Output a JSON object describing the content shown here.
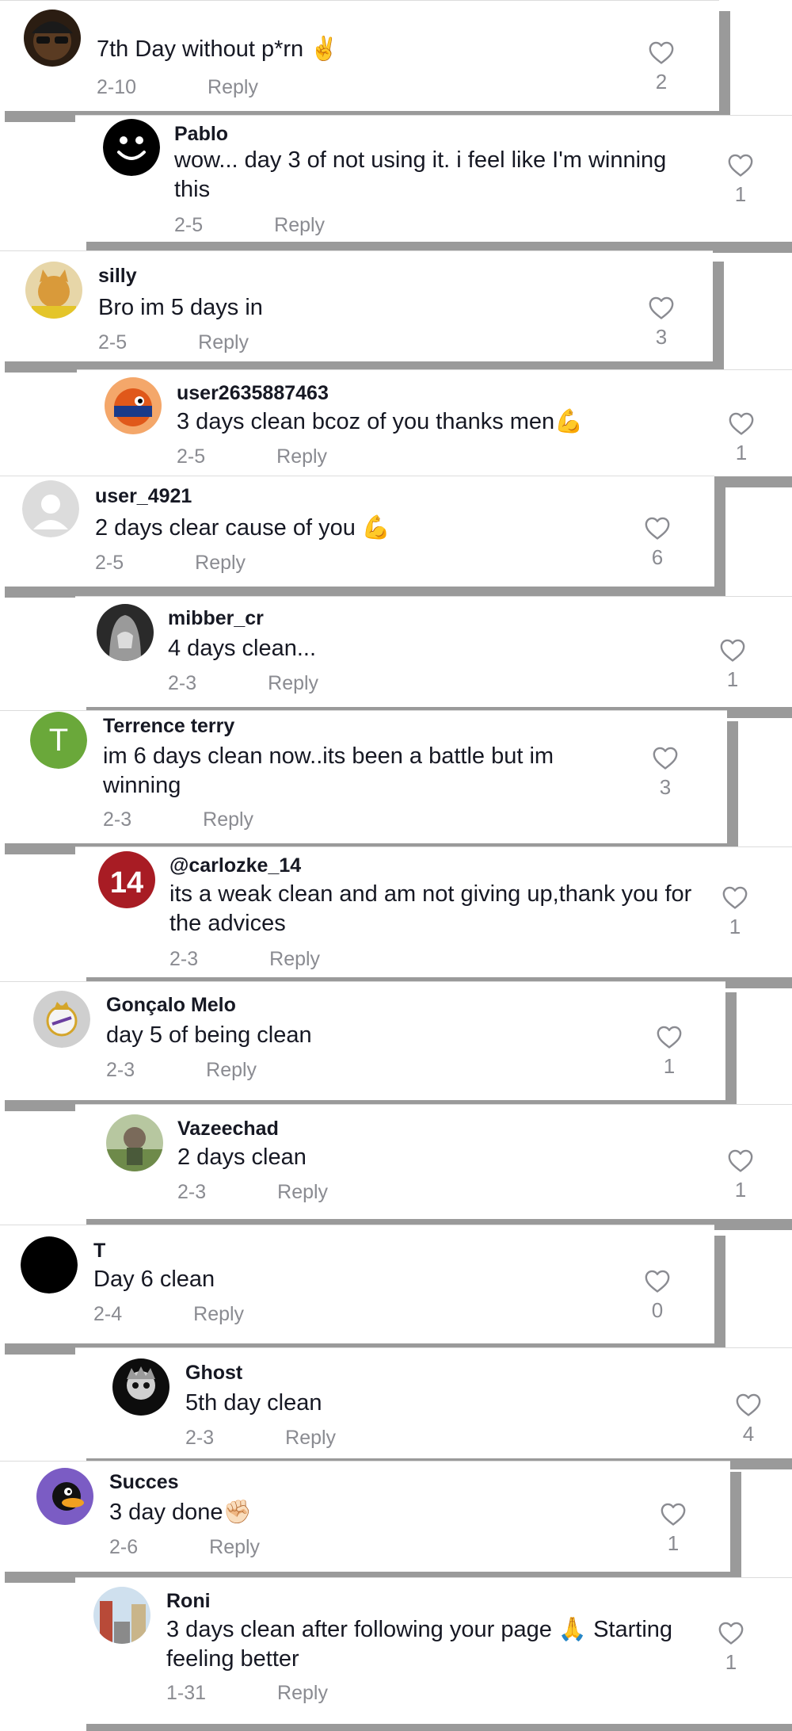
{
  "comments": [
    {
      "user": "",
      "text": "7th Day without p*rn ✌️",
      "date": "2-10",
      "reply": "Reply",
      "likes": "2",
      "avatar": {
        "kind": "photo-dark-sunglasses",
        "color": "#3a2a1a"
      }
    },
    {
      "user": "Pablo",
      "text": "wow... day 3 of not using it. i feel like I'm winning this",
      "date": "2-5",
      "reply": "Reply",
      "likes": "1",
      "avatar": {
        "kind": "smiley",
        "color": "#000000"
      }
    },
    {
      "user": "silly",
      "text": "Bro im 5 days in",
      "date": "2-5",
      "reply": "Reply",
      "likes": "3",
      "avatar": {
        "kind": "photo-cat",
        "color": "#c9a34a"
      }
    },
    {
      "user": "user2635887463",
      "text": "3 days clean bcoz of you thanks men💪",
      "date": "2-5",
      "reply": "Reply",
      "likes": "1",
      "avatar": {
        "kind": "photo-ball",
        "color": "#d0541c"
      }
    },
    {
      "user": "user_4921",
      "text": "2 days clear cause of you 💪",
      "date": "2-5",
      "reply": "Reply",
      "likes": "6",
      "avatar": {
        "kind": "default-person",
        "color": "#d9d9d9"
      }
    },
    {
      "user": "mibber_cr",
      "text": "4 days clean...",
      "date": "2-3",
      "reply": "Reply",
      "likes": "1",
      "avatar": {
        "kind": "photo-hooded",
        "color": "#4a4a4a"
      }
    },
    {
      "user": "Terrence terry",
      "text": "im 6 days clean now..its been a battle but im winning",
      "date": "2-3",
      "reply": "Reply",
      "likes": "3",
      "avatar": {
        "kind": "initial",
        "letter": "T",
        "color": "#6aa83a"
      }
    },
    {
      "user": "@carlozke_14",
      "text": "its a weak clean and am not giving up,thank you for the advices",
      "date": "2-3",
      "reply": "Reply",
      "likes": "1",
      "avatar": {
        "kind": "photo-jersey",
        "color": "#b3202a"
      }
    },
    {
      "user": "Gonçalo Melo",
      "text": "day 5 of being clean",
      "date": "2-3",
      "reply": "Reply",
      "likes": "1",
      "avatar": {
        "kind": "crest",
        "color": "#c9c9c9"
      }
    },
    {
      "user": "Vazeechad",
      "text": "2 days clean",
      "date": "2-3",
      "reply": "Reply",
      "likes": "1",
      "avatar": {
        "kind": "photo-outdoor",
        "color": "#8a9a6a"
      }
    },
    {
      "user": "T",
      "text": "Day 6 clean",
      "date": "2-4",
      "reply": "Reply",
      "likes": "0",
      "avatar": {
        "kind": "solid",
        "color": "#000000"
      }
    },
    {
      "user": "Ghost",
      "text": "5th day clean",
      "date": "2-3",
      "reply": "Reply",
      "likes": "4",
      "avatar": {
        "kind": "photo-skull",
        "color": "#1a1a1a"
      }
    },
    {
      "user": "Succes",
      "text": "3 day done✊🏻",
      "date": "2-6",
      "reply": "Reply",
      "likes": "1",
      "avatar": {
        "kind": "photo-duck",
        "color": "#7b5cc4"
      }
    },
    {
      "user": "Roni",
      "text": "3 days clean after following your page 🙏 Starting feeling better",
      "date": "1-31",
      "reply": "Reply",
      "likes": "1",
      "avatar": {
        "kind": "photo-street",
        "color": "#a04a3a"
      }
    }
  ]
}
